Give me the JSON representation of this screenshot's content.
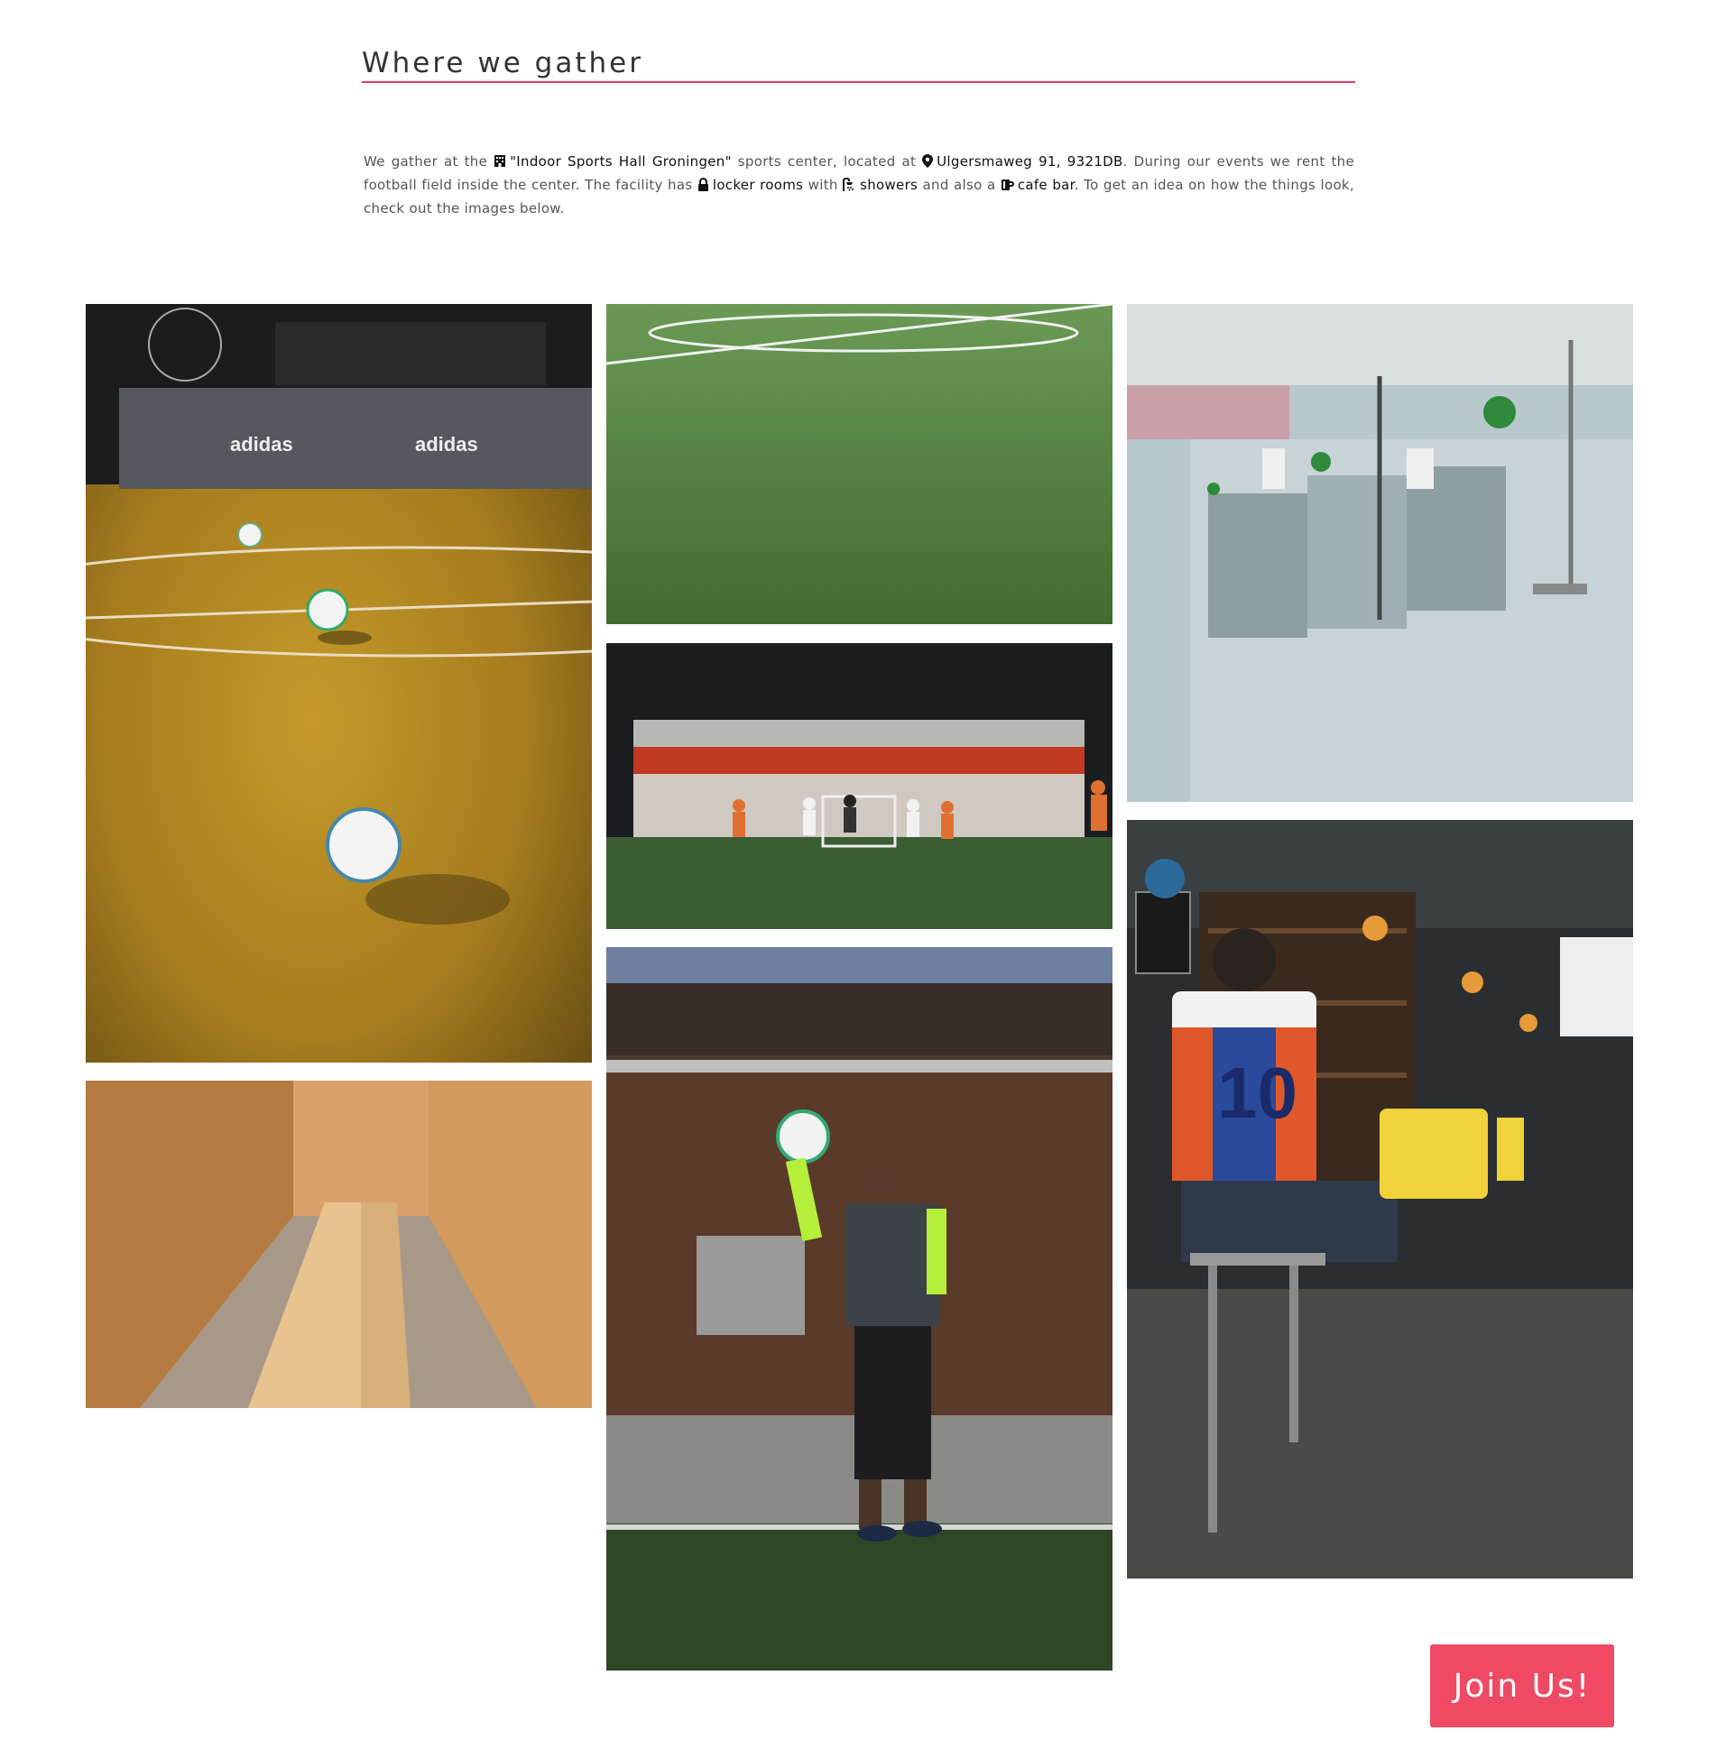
{
  "section": {
    "title": "Where we gather"
  },
  "intro": {
    "p1": "We gather at the",
    "venue": "\"Indoor Sports Hall Groningen\"",
    "p2": "sports center, located at",
    "address": "Ulgersmaweg 91, 9321DB",
    "p3": ". During our events we rent the football field inside the center. The facility has",
    "lockers": "locker rooms",
    "p4": "with",
    "showers": "showers",
    "p5": "and also a",
    "cafe": "cafe bar",
    "p6": ". To get an idea on how the things look, check out the images below."
  },
  "icons": {
    "venue": "building-icon",
    "address": "map-pin-icon",
    "lockers": "lock-icon",
    "showers": "shower-icon",
    "cafe": "mug-icon"
  },
  "gallery": {
    "images": [
      "indoor-pitch-with-balls",
      "artificial-turf-field",
      "shower-room",
      "players-in-cage-field",
      "locker-room",
      "goalkeeper-catching-ball",
      "cafe-bar-fans"
    ],
    "ads_text": "adidas",
    "jersey_number": "10"
  },
  "cta": {
    "join_label": "Join Us!"
  },
  "colors": {
    "accent": "#e0395a",
    "button": "#ee4a63"
  }
}
